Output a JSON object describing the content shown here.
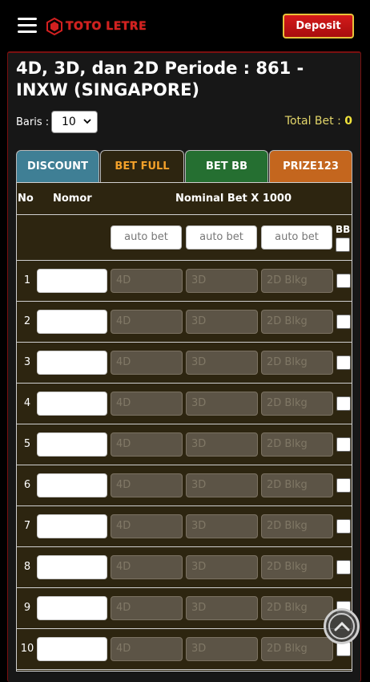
{
  "header": {
    "logo_text": "TOTO LETRE",
    "deposit_label": "Deposit"
  },
  "page": {
    "title": "4D, 3D, dan 2D Periode : 861 - INXW (SINGAPORE)",
    "baris_label": "Baris :",
    "baris_value": "10",
    "total_bet_label": "Total Bet :",
    "total_bet_value": "0"
  },
  "tabs": {
    "discount": "DISCOUNT",
    "bet_full": "BET FULL",
    "bet_bb": "BET BB",
    "prize123": "PRIZE123"
  },
  "table": {
    "col_no": "No",
    "col_nomor": "Nomor",
    "col_nominal": "Nominal Bet X 1000",
    "auto_bet_placeholder": "auto bet",
    "bb_label": "BB",
    "placeholder_4d": "4D",
    "placeholder_3d": "3D",
    "placeholder_2d": "2D Blkg",
    "rows": [
      "1",
      "2",
      "3",
      "4",
      "5",
      "6",
      "7",
      "8",
      "9",
      "10"
    ]
  },
  "colors": {
    "brand_red": "#d41a1a",
    "deposit_border": "#e8c23a",
    "table_bg": "#2d2510",
    "tab_discount": "#3f7f95",
    "tab_bet_bb": "#256f31",
    "tab_prize": "#c4661e",
    "total_bet": "#f0e23b"
  },
  "icons": {
    "menu": "hamburger-icon",
    "logo": "logo-mark-icon",
    "select": "chevron-down-icon",
    "scroll": "chevron-up-icon"
  }
}
